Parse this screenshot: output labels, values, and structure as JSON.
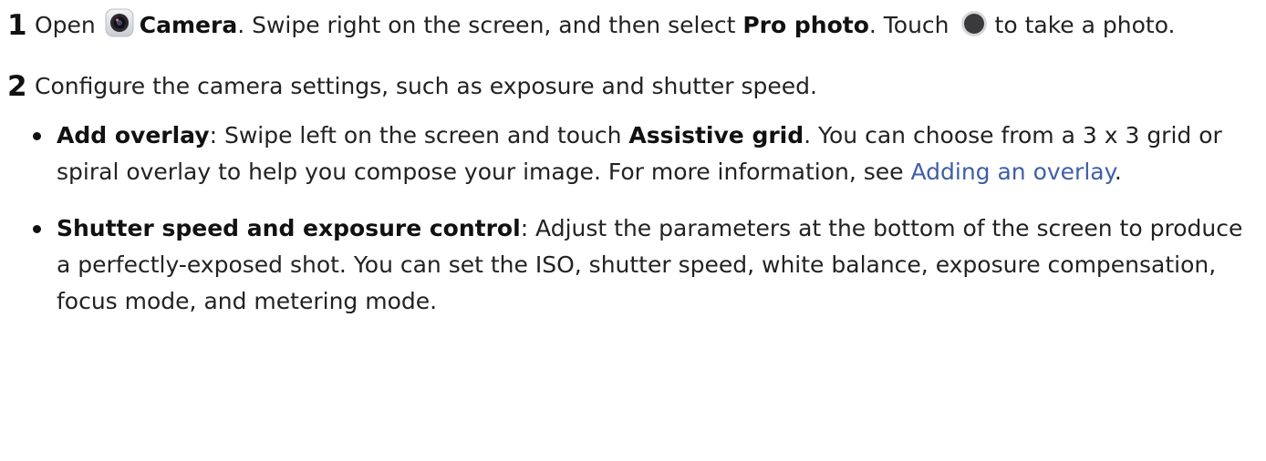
{
  "steps": [
    {
      "number": "1",
      "parts": {
        "open": "Open",
        "camera_label": "Camera",
        "swipe_text": ". Swipe right on the screen, and then select ",
        "pro_photo_label": "Pro photo",
        "touch_text": ". Touch",
        "take_photo_text": "to take a photo."
      },
      "icons": [
        "camera-app-icon",
        "shutter-button-icon"
      ]
    },
    {
      "number": "2",
      "text": "Configure the camera settings, such as exposure and shutter speed.",
      "bullets": [
        {
          "label": "Add overlay",
          "text_before": ": Swipe left on the screen and touch ",
          "bold_inline": "Assistive grid",
          "text_after": ". You can choose from a 3 x 3 grid or spiral overlay to help you compose your image. For more information, see ",
          "link_text": "Adding an overlay",
          "end": "."
        },
        {
          "label": "Shutter speed and exposure control",
          "text": ": Adjust the parameters at the bottom of the screen to produce a perfectly-exposed shot. You can set the ISO, shutter speed, white balance, exposure compensation, focus mode, and metering mode."
        }
      ]
    }
  ],
  "colors": {
    "text": "#222222",
    "link": "#3f5fa8"
  }
}
